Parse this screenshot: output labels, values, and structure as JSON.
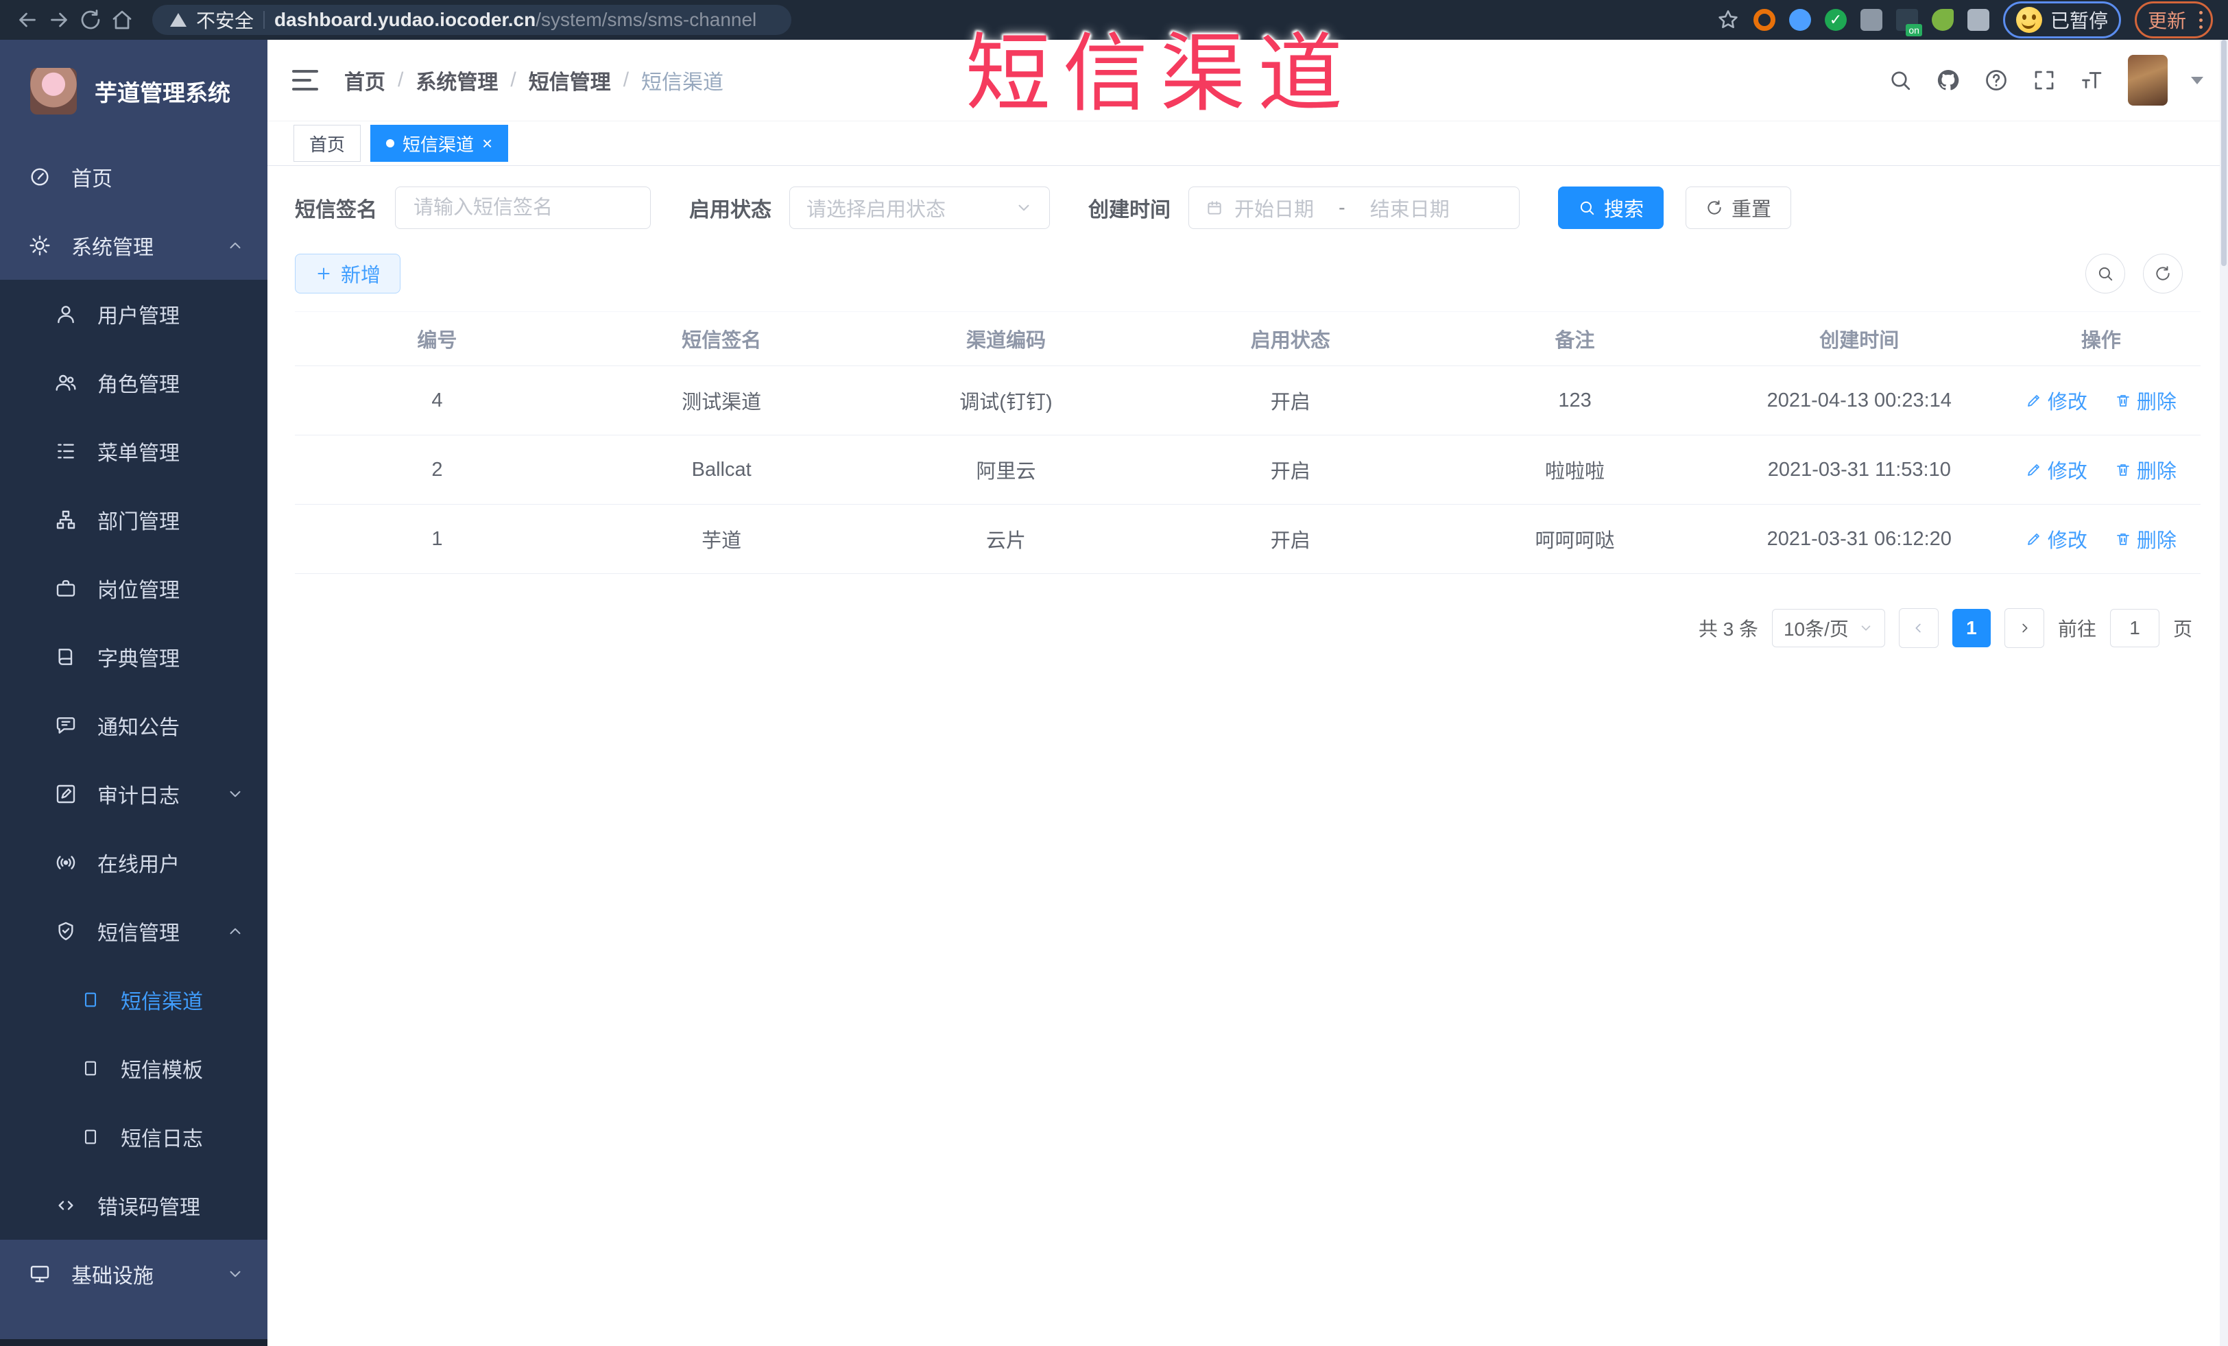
{
  "browser": {
    "security_label": "不安全",
    "url_host": "dashboard.yudao.iocoder.cn",
    "url_path": "/system/sms/sms-channel",
    "paused_badge": "已暂停",
    "update_button": "更新"
  },
  "overlay": {
    "title": "短信渠道"
  },
  "sidebar": {
    "app_title": "芋道管理系统",
    "items": [
      {
        "label": "首页"
      },
      {
        "label": "系统管理"
      },
      {
        "label": "用户管理"
      },
      {
        "label": "角色管理"
      },
      {
        "label": "菜单管理"
      },
      {
        "label": "部门管理"
      },
      {
        "label": "岗位管理"
      },
      {
        "label": "字典管理"
      },
      {
        "label": "通知公告"
      },
      {
        "label": "审计日志"
      },
      {
        "label": "在线用户"
      },
      {
        "label": "短信管理"
      },
      {
        "label": "短信渠道"
      },
      {
        "label": "短信模板"
      },
      {
        "label": "短信日志"
      },
      {
        "label": "错误码管理"
      },
      {
        "label": "基础设施"
      }
    ]
  },
  "header": {
    "breadcrumb": [
      {
        "label": "首页"
      },
      {
        "label": "系统管理"
      },
      {
        "label": "短信管理"
      },
      {
        "label": "短信渠道"
      }
    ]
  },
  "tags": [
    {
      "label": "首页"
    },
    {
      "label": "短信渠道"
    }
  ],
  "filter": {
    "sign_label": "短信签名",
    "sign_placeholder": "请输入短信签名",
    "status_label": "启用状态",
    "status_placeholder": "请选择启用状态",
    "time_label": "创建时间",
    "start_placeholder": "开始日期",
    "range_separator": "-",
    "end_placeholder": "结束日期",
    "search_label": "搜索",
    "reset_label": "重置"
  },
  "toolbar": {
    "add_label": "新增"
  },
  "table": {
    "headers": [
      "编号",
      "短信签名",
      "渠道编码",
      "启用状态",
      "备注",
      "创建时间",
      "操作"
    ],
    "edit_label": "修改",
    "delete_label": "删除",
    "rows": [
      {
        "id": "4",
        "sign": "测试渠道",
        "code": "调试(钉钉)",
        "status": "开启",
        "remark": "123",
        "created": "2021-04-13 00:23:14"
      },
      {
        "id": "2",
        "sign": "Ballcat",
        "code": "阿里云",
        "status": "开启",
        "remark": "啦啦啦",
        "created": "2021-03-31 11:53:10"
      },
      {
        "id": "1",
        "sign": "芋道",
        "code": "云片",
        "status": "开启",
        "remark": "呵呵呵哒",
        "created": "2021-03-31 06:12:20"
      }
    ]
  },
  "pagination": {
    "total": "共 3 条",
    "page_size": "10条/页",
    "current": "1",
    "goto_label": "前往",
    "goto_value": "1",
    "page_unit": "页"
  },
  "icons": {
    "hamburger": "three-bars",
    "search": "magnifier",
    "github": "github-mark",
    "help": "question-circle",
    "fullscreen": "expand-arrows",
    "font_size": "T",
    "close": "×",
    "active_tag_dot": "●",
    "add": "+",
    "calendar": "grid-calendar",
    "edit": "pencil",
    "delete": "trash",
    "reset": "refresh-arrow",
    "chevron_left": "‹",
    "chevron_right": "›"
  },
  "colors": {
    "accent_blue": "#1e90ff",
    "link_blue": "#409eff",
    "sidebar_bg": "#212e44",
    "sidebar_band": "#364569",
    "chrome_bg": "#1f2a38",
    "overlay_red": "#f53b5e",
    "tag_active": "#1e90ff"
  }
}
